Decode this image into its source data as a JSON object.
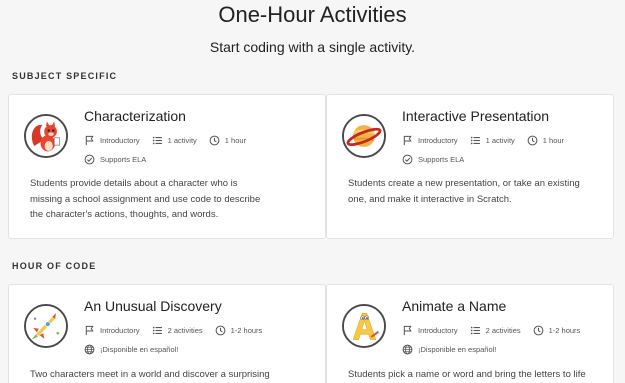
{
  "header": {
    "title": "One-Hour Activities",
    "subtitle": "Start coding with a single activity."
  },
  "sections": [
    {
      "heading": "SUBJECT SPECIFIC",
      "cards": [
        {
          "title": "Characterization",
          "icon": "squirrel-icon",
          "level": "Introductory",
          "activities": "1 activity",
          "duration": "1 hour",
          "tag": "Supports ELA",
          "tag_icon": "check-circle-icon",
          "description": [
            "Students provide details about a character who is",
            "missing a school assignment and use code to describe",
            "the character's actions, thoughts, and words."
          ]
        },
        {
          "title": "Interactive Presentation",
          "icon": "planet-icon",
          "level": "Introductory",
          "activities": "1 activity",
          "duration": "1 hour",
          "tag": "Supports ELA",
          "tag_icon": "check-circle-icon",
          "description": [
            "Students create a new presentation, or take an existing",
            "one, and make it interactive in Scratch."
          ]
        }
      ]
    },
    {
      "heading": "HOUR OF CODE",
      "cards": [
        {
          "title": "An Unusual Discovery",
          "icon": "rocket-icon",
          "level": "Introductory",
          "activities": "2 activities",
          "duration": "1-2 hours",
          "tag": "¡Disponible en español!",
          "tag_icon": "globe-icon",
          "description": [
            "Two characters meet in a world and discover a surprising"
          ]
        },
        {
          "title": "Animate a Name",
          "icon": "letter-a-icon",
          "level": "Introductory",
          "activities": "2 activities",
          "duration": "1-2 hours",
          "tag": "¡Disponible en español!",
          "tag_icon": "globe-icon",
          "description": [
            "Students pick a name or word and bring the letters to life"
          ]
        }
      ]
    }
  ]
}
